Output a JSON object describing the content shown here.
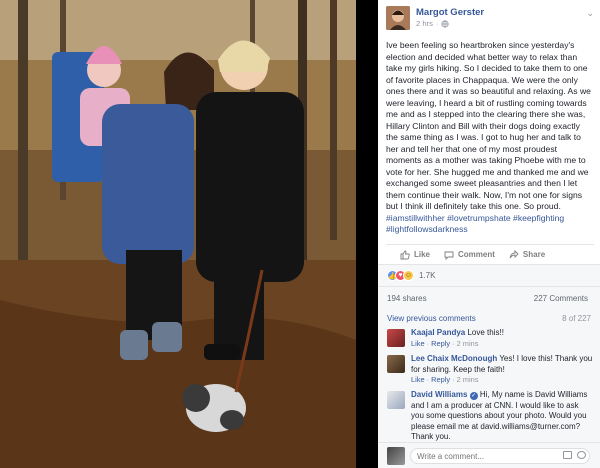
{
  "post": {
    "author": "Margot Gerster",
    "time": "2 hrs",
    "privacy_icon": "globe-icon",
    "text": "Ive been feeling so heartbroken since yesterday's election and decided what better way to relax than take my girls hiking. So I decided to take them to one of favorite places in Chappaqua. We were the only ones there and it was so beautiful and relaxing. As we were leaving, I heard a bit of rustling coming towards me and as I stepped into the clearing there she was, Hillary Clinton and Bill with their dogs doing exactly the same thing as I was. I got to hug her and talk to her and tell her that one of my most proudest moments as a mother was taking Phoebe with me to vote for her. She hugged me and thanked me and we exchanged some sweet pleasantries and then I let them continue their walk. Now, I'm not one for signs but I think ill definitely take this one. So proud.",
    "hashtags": "#iamstillwithher #lovetrumpshate #keepfighting #lightfollowsdarkness"
  },
  "actions": {
    "like": "Like",
    "comment": "Comment",
    "share": "Share"
  },
  "reactions": {
    "count": "1.7K",
    "types": [
      "like",
      "love",
      "wow"
    ]
  },
  "stats": {
    "shares": "194 shares",
    "comments": "227 Comments"
  },
  "comments_section": {
    "view_previous": "View previous comments",
    "count": "8 of 227",
    "items": [
      {
        "name": "Kaajal Pandya",
        "text": "Love this!!",
        "like": "Like",
        "reply": "Reply",
        "time": "2 mins"
      },
      {
        "name": "Lee Chaix McDonough",
        "text": "Yes! I love this! Thank you for sharing. Keep the faith!",
        "like": "Like",
        "reply": "Reply",
        "time": "2 mins"
      },
      {
        "name": "David Williams",
        "text": "Hi, My name is David Williams and I am a producer at CNN. I would like to ask you some questions about your photo. Would you please email me at david.williams@turner.com? Thank you."
      }
    ]
  },
  "write_comment": {
    "placeholder": "Write a comment..."
  },
  "colors": {
    "link": "#365899",
    "muted": "#90949c",
    "like_blue": "#5890ff",
    "love_red": "#f25268",
    "wow_yellow": "#f7c94a"
  }
}
